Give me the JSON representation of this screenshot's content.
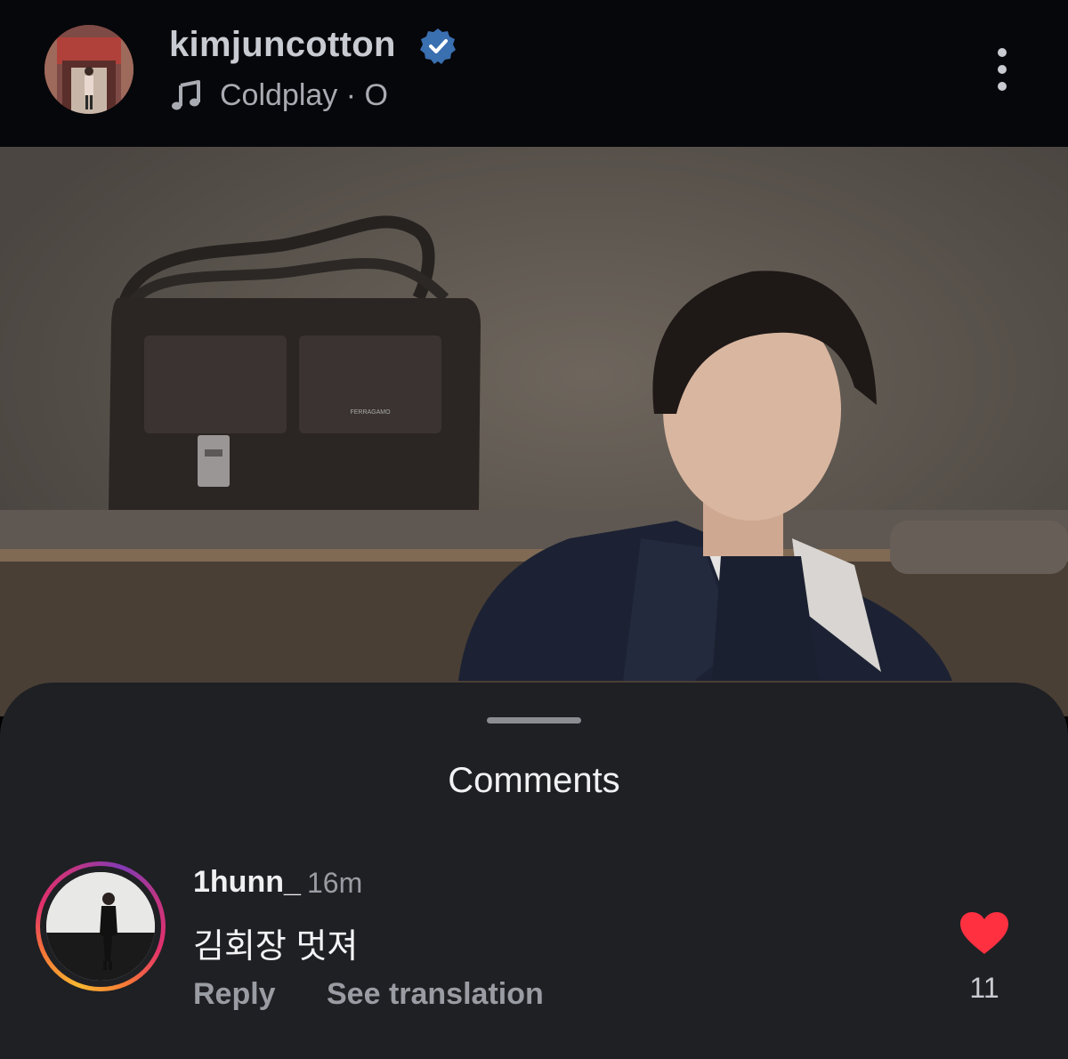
{
  "header": {
    "username": "kimjuncotton",
    "music": "Coldplay · O",
    "icons": {
      "verified": "verified-badge-icon",
      "music": "music-note-icon",
      "more": "more-options-icon"
    },
    "colors": {
      "verified": "#3897f0"
    }
  },
  "photo": {
    "bag_brand": "FERRAGAMO"
  },
  "comments": {
    "title": "Comments",
    "items": [
      {
        "user": "1hunn_",
        "time": "16m",
        "text": "김회장 멋져",
        "reply_label": "Reply",
        "translate_label": "See translation",
        "likes": "11",
        "liked": true
      }
    ],
    "colors": {
      "heart": "#ff3040"
    }
  }
}
